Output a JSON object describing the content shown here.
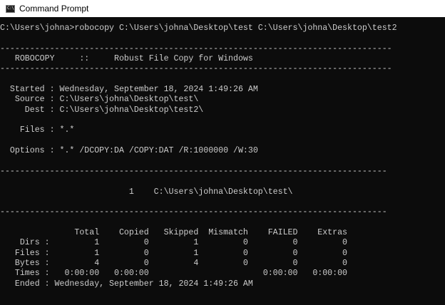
{
  "window": {
    "title": "Command Prompt",
    "icon": "command-prompt-icon",
    "icon_glyph": "C:\\"
  },
  "console": {
    "lines": [
      "C:\\Users\\johna>robocopy C:\\Users\\johna\\Desktop\\test C:\\Users\\johna\\Desktop\\test2",
      "",
      "-------------------------------------------------------------------------------",
      "   ROBOCOPY     ::     Robust File Copy for Windows",
      "-------------------------------------------------------------------------------",
      "",
      "  Started : Wednesday, September 18, 2024 1:49:26 AM",
      "   Source : C:\\Users\\johna\\Desktop\\test\\",
      "     Dest : C:\\Users\\johna\\Desktop\\test2\\",
      "",
      "    Files : *.*",
      "",
      "  Options : *.* /DCOPY:DA /COPY:DAT /R:1000000 /W:30",
      "",
      "------------------------------------------------------------------------------",
      "",
      "                          1    C:\\Users\\johna\\Desktop\\test\\",
      "",
      "------------------------------------------------------------------------------",
      "",
      "               Total    Copied   Skipped  Mismatch    FAILED    Extras",
      "    Dirs :         1         0         1         0         0         0",
      "   Files :         1         0         1         0         0         0",
      "   Bytes :         4         0         4         0         0         0",
      "   Times :   0:00:00   0:00:00                       0:00:00   0:00:00",
      "   Ended : Wednesday, September 18, 2024 1:49:26 AM"
    ]
  },
  "colors": {
    "background": "#0c0c0c",
    "text": "#cccccc",
    "titlebar": "#ffffff"
  }
}
